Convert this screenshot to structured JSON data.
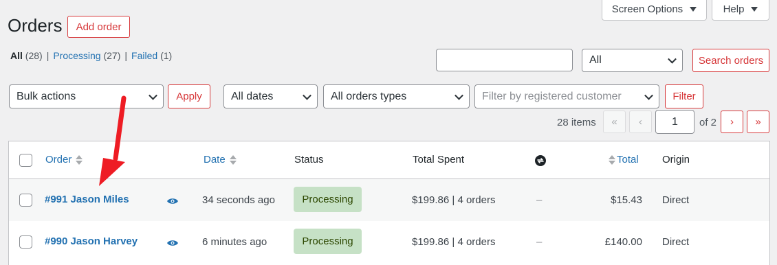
{
  "header": {
    "screen_options_label": "Screen Options",
    "help_label": "Help",
    "title": "Orders",
    "add_order_label": "Add order"
  },
  "filters_links": {
    "all_label": "All",
    "all_count": "(28)",
    "processing_label": "Processing",
    "processing_count": "(27)",
    "failed_label": "Failed",
    "failed_count": "(1)",
    "separator": "|"
  },
  "search": {
    "input_value": "",
    "scope_select": "All",
    "button_label": "Search orders"
  },
  "toolbar": {
    "bulk_actions": "Bulk actions",
    "apply_label": "Apply",
    "dates_select": "All dates",
    "types_select": "All orders types",
    "customer_placeholder": "Filter by registered customer",
    "filter_label": "Filter"
  },
  "pagination": {
    "items_count": "28 items",
    "first": "«",
    "prev": "‹",
    "current_page": "1",
    "of_label": "of 2",
    "next": "›",
    "last": "»"
  },
  "table": {
    "columns": {
      "order": "Order",
      "date": "Date",
      "status": "Status",
      "total_spent": "Total Spent",
      "total": "Total",
      "origin": "Origin"
    },
    "rows": [
      {
        "order": "#991 Jason Miles",
        "date": "34 seconds ago",
        "status": "Processing",
        "total_spent": "$199.86 | 4 orders",
        "sync": "–",
        "total": "$15.43",
        "origin": "Direct"
      },
      {
        "order": "#990 Jason Harvey",
        "date": "6 minutes ago",
        "status": "Processing",
        "total_spent": "$199.86 | 4 orders",
        "sync": "–",
        "total": "£140.00",
        "origin": "Direct"
      }
    ]
  },
  "colors": {
    "accent_red": "#d63638",
    "link_blue": "#2271b1",
    "status_processing_bg": "#c6e1c6",
    "annotation_arrow": "#ee1c24"
  }
}
